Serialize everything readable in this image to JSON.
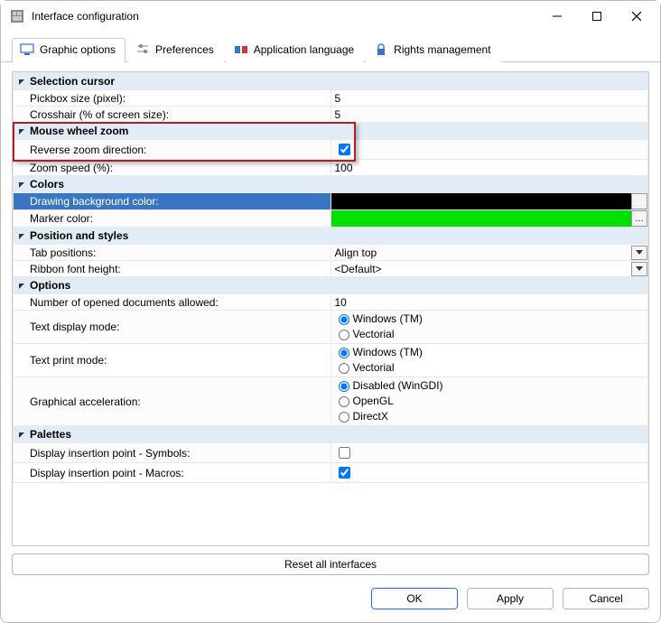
{
  "window": {
    "title": "Interface configuration"
  },
  "tabs": {
    "graphic": {
      "label": "Graphic options",
      "active": true
    },
    "prefs": {
      "label": "Preferences",
      "active": false
    },
    "lang": {
      "label": "Application language",
      "active": false
    },
    "rights": {
      "label": "Rights management",
      "active": false
    }
  },
  "sections": {
    "selection_cursor": {
      "title": "Selection cursor",
      "pickbox_label": "Pickbox size (pixel):",
      "pickbox_value": "5",
      "crosshair_label": "Crosshair (% of screen size):",
      "crosshair_value": "5"
    },
    "mouse_wheel_zoom": {
      "title": "Mouse wheel zoom",
      "reverse_label": "Reverse zoom direction:",
      "reverse_checked": true,
      "speed_label": "Zoom speed (%):",
      "speed_value": "100"
    },
    "colors": {
      "title": "Colors",
      "bg_label": "Drawing background color:",
      "bg_color": "#000000",
      "marker_label": "Marker color:",
      "marker_color": "#00e000"
    },
    "position_styles": {
      "title": "Position and styles",
      "tabpos_label": "Tab positions:",
      "tabpos_value": "Align top",
      "ribbon_label": "Ribbon font height:",
      "ribbon_value": "<Default>"
    },
    "options": {
      "title": "Options",
      "docs_label": "Number of opened documents allowed:",
      "docs_value": "10",
      "text_display_label": "Text display mode:",
      "text_display_mode": {
        "windows": "Windows (TM)",
        "vectorial": "Vectorial",
        "selected": "windows"
      },
      "text_print_label": "Text print mode:",
      "text_print_mode": {
        "windows": "Windows (TM)",
        "vectorial": "Vectorial",
        "selected": "windows"
      },
      "gaccel_label": "Graphical acceleration:",
      "gaccel": {
        "disabled": "Disabled (WinGDI)",
        "opengl": "OpenGL",
        "directx": "DirectX",
        "selected": "disabled"
      }
    },
    "palettes": {
      "title": "Palettes",
      "symbols_label": "Display insertion point - Symbols:",
      "symbols_checked": false,
      "macros_label": "Display insertion point - Macros:",
      "macros_checked": true
    }
  },
  "buttons": {
    "reset": "Reset all interfaces",
    "ok": "OK",
    "apply": "Apply",
    "cancel": "Cancel"
  }
}
